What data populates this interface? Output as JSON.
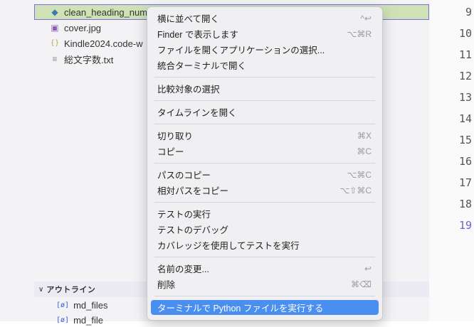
{
  "explorer": {
    "partial_text": "",
    "files": [
      {
        "name": "clean_heading_num",
        "icon": "python-icon",
        "glyph": "◆",
        "color": "#3b78b4"
      },
      {
        "name": "cover.jpg",
        "icon": "image-icon",
        "glyph": "▣",
        "color": "#8b5fb8"
      },
      {
        "name": "Kindle2024.code-w",
        "icon": "json-braces-icon",
        "glyph": "{ }",
        "color": "#b99a2e"
      },
      {
        "name": "総文字数.txt",
        "icon": "text-file-icon",
        "glyph": "≡",
        "color": "#8a8a8a"
      }
    ]
  },
  "outline": {
    "chevron": "∨",
    "title": "アウトライン",
    "items": [
      {
        "name": "md_files",
        "glyph": "[ø]"
      },
      {
        "name": "md_file",
        "glyph": "[ø]"
      }
    ]
  },
  "gutter": {
    "lines": [
      "9",
      "10",
      "11",
      "12",
      "13",
      "14",
      "15",
      "16",
      "17",
      "18",
      "19"
    ],
    "current": "19"
  },
  "context_menu": {
    "items": [
      {
        "label": "横に並べて開く",
        "shortcut": "^↩"
      },
      {
        "label": "Finder で表示します",
        "shortcut": "⌥⌘R"
      },
      {
        "label": "ファイルを開くアプリケーションの選択...",
        "shortcut": ""
      },
      {
        "label": "統合ターミナルで開く",
        "shortcut": ""
      },
      {
        "label": "比較対象の選択",
        "shortcut": ""
      },
      {
        "label": "タイムラインを開く",
        "shortcut": ""
      },
      {
        "label": "切り取り",
        "shortcut": "⌘X"
      },
      {
        "label": "コピー",
        "shortcut": "⌘C"
      },
      {
        "label": "パスのコピー",
        "shortcut": "⌥⌘C"
      },
      {
        "label": "相対パスをコピー",
        "shortcut": "⌥⇧⌘C"
      },
      {
        "label": "テストの実行",
        "shortcut": ""
      },
      {
        "label": "テストのデバッグ",
        "shortcut": ""
      },
      {
        "label": "カバレッジを使用してテストを実行",
        "shortcut": ""
      },
      {
        "label": "名前の変更...",
        "shortcut": "↩"
      },
      {
        "label": "削除",
        "shortcut": "⌘⌫"
      },
      {
        "label": "ターミナルで Python ファイルを実行する",
        "shortcut": ""
      }
    ],
    "highlight_color": "#4a8ff0"
  }
}
